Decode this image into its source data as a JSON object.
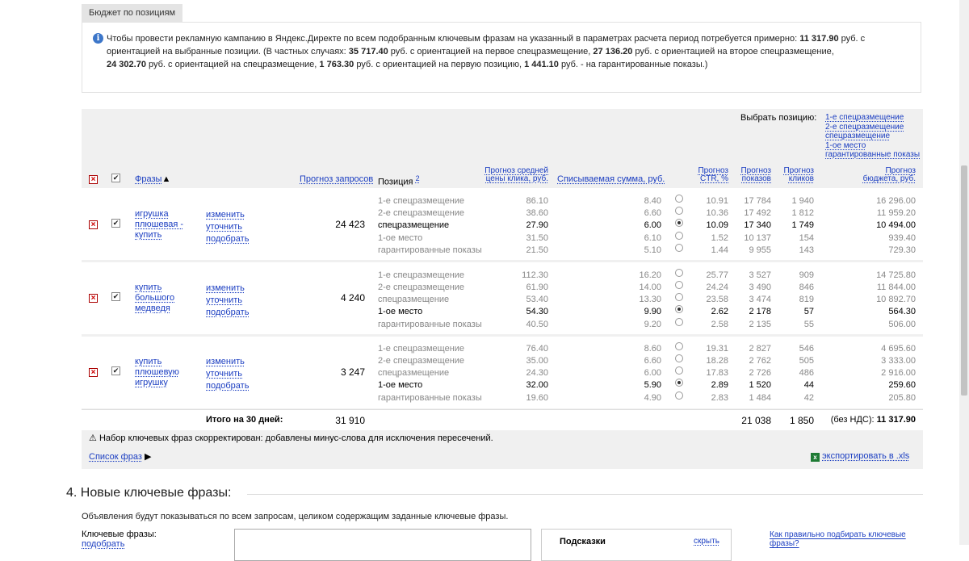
{
  "budget": {
    "tab_label": "Бюджет по позициям",
    "info": {
      "t1": "Чтобы провести рекламную кампанию в Яндекс.Директе по всем подобранным ключевым фразам на указанный в параметрах расчета период потребуется примерно:",
      "v1": "11 317.90",
      "t2": "руб. с ориентацией на выбранные позиции. (В частных случаях:",
      "v2": "35 717.40",
      "t3": "руб. с ориентацией на первое спецразмещение,",
      "v3": "27 136.20",
      "t4": "руб. с ориентацией на второе спецразмещение,",
      "v4": "24 302.70",
      "t5": "руб. с ориентацией на спецразмещение,",
      "v5": "1 763.30",
      "t6": "руб. с ориентацией на первую позицию,",
      "v6": "1 441.10",
      "t7": "руб. - на гарантированные показы.)"
    }
  },
  "table": {
    "select_position": {
      "label": "Выбрать позицию:",
      "options": [
        "1-е спецразмещение",
        "2-е спецразмещение",
        "спецразмещение",
        "1-ое место",
        "гарантированные показы"
      ]
    },
    "headers": {
      "phrases": "Фразы",
      "sort_arrow": "▲",
      "requests": "Прогноз запросов",
      "position": "Позиция",
      "position_footnote": "2",
      "avg_price_1": "Прогноз средней",
      "avg_price_2": "цены клика, руб.",
      "charged": "Списываемая сумма, руб.",
      "ctr_1": "Прогноз",
      "ctr_2": "CTR, %",
      "shows_1": "Прогноз",
      "shows_2": "показов",
      "clicks_1": "Прогноз",
      "clicks_2": "кликов",
      "budget_1": "Прогноз",
      "budget_2": "бюджета, руб."
    },
    "row_actions": [
      "изменить",
      "уточнить",
      "подобрать"
    ],
    "rows": [
      {
        "phrase_lines": [
          "игрушка",
          "плюшевая -",
          "купить"
        ],
        "requests": "24 423",
        "selected": 2,
        "positions": [
          {
            "pos": "1-е спецразмещение",
            "price": "86.10",
            "charged": "8.40",
            "ctr": "10.91",
            "shows": "17 784",
            "clicks": "1 940",
            "budget": "16 296.00"
          },
          {
            "pos": "2-е спецразмещение",
            "price": "38.60",
            "charged": "6.60",
            "ctr": "10.36",
            "shows": "17 492",
            "clicks": "1 812",
            "budget": "11 959.20"
          },
          {
            "pos": "спецразмещение",
            "price": "27.90",
            "charged": "6.00",
            "ctr": "10.09",
            "shows": "17 340",
            "clicks": "1 749",
            "budget": "10 494.00"
          },
          {
            "pos": "1-ое место",
            "price": "31.50",
            "charged": "6.10",
            "ctr": "1.52",
            "shows": "10 137",
            "clicks": "154",
            "budget": "939.40"
          },
          {
            "pos": "гарантированные показы",
            "price": "21.50",
            "charged": "5.10",
            "ctr": "1.44",
            "shows": "9 955",
            "clicks": "143",
            "budget": "729.30"
          }
        ]
      },
      {
        "phrase_lines": [
          "купить",
          "большого",
          "медведя"
        ],
        "requests": "4 240",
        "selected": 3,
        "positions": [
          {
            "pos": "1-е спецразмещение",
            "price": "112.30",
            "charged": "16.20",
            "ctr": "25.77",
            "shows": "3 527",
            "clicks": "909",
            "budget": "14 725.80"
          },
          {
            "pos": "2-е спецразмещение",
            "price": "61.90",
            "charged": "14.00",
            "ctr": "24.24",
            "shows": "3 490",
            "clicks": "846",
            "budget": "11 844.00"
          },
          {
            "pos": "спецразмещение",
            "price": "53.40",
            "charged": "13.30",
            "ctr": "23.58",
            "shows": "3 474",
            "clicks": "819",
            "budget": "10 892.70"
          },
          {
            "pos": "1-ое место",
            "price": "54.30",
            "charged": "9.90",
            "ctr": "2.62",
            "shows": "2 178",
            "clicks": "57",
            "budget": "564.30"
          },
          {
            "pos": "гарантированные показы",
            "price": "40.50",
            "charged": "9.20",
            "ctr": "2.58",
            "shows": "2 135",
            "clicks": "55",
            "budget": "506.00"
          }
        ]
      },
      {
        "phrase_lines": [
          "купить",
          "плюшевую",
          "игрушку"
        ],
        "requests": "3 247",
        "selected": 3,
        "positions": [
          {
            "pos": "1-е спецразмещение",
            "price": "76.40",
            "charged": "8.60",
            "ctr": "19.31",
            "shows": "2 827",
            "clicks": "546",
            "budget": "4 695.60"
          },
          {
            "pos": "2-е спецразмещение",
            "price": "35.00",
            "charged": "6.60",
            "ctr": "18.28",
            "shows": "2 762",
            "clicks": "505",
            "budget": "3 333.00"
          },
          {
            "pos": "спецразмещение",
            "price": "24.30",
            "charged": "6.00",
            "ctr": "17.83",
            "shows": "2 726",
            "clicks": "486",
            "budget": "2 916.00"
          },
          {
            "pos": "1-ое место",
            "price": "32.00",
            "charged": "5.90",
            "ctr": "2.89",
            "shows": "1 520",
            "clicks": "44",
            "budget": "259.60"
          },
          {
            "pos": "гарантированные показы",
            "price": "19.60",
            "charged": "4.90",
            "ctr": "2.83",
            "shows": "1 484",
            "clicks": "42",
            "budget": "205.80"
          }
        ]
      }
    ],
    "totals": {
      "label": "Итого на 30 дней:",
      "requests": "31 910",
      "shows": "21 038",
      "clicks": "1 850",
      "vat_label": "(без НДС):",
      "budget": "11 317.90"
    },
    "warning": "Набор ключевых фраз скорректирован: добавлены минус-слова для исключения пересечений.",
    "phrase_list_link": "Список фраз",
    "export_link": "экспортировать в .xls"
  },
  "section4": {
    "number": "4.",
    "title": "Новые ключевые фразы:",
    "description": "Объявления будут показываться по всем запросам, целиком содержащим заданные ключевые фразы.",
    "kw_label": "Ключевые фразы:",
    "kw_link": "подобрать",
    "hints_title": "Подсказки",
    "hints_hide": "скрыть",
    "help_link_1": "Как правильно подбирать ключевые",
    "help_link_2": "фразы?"
  }
}
